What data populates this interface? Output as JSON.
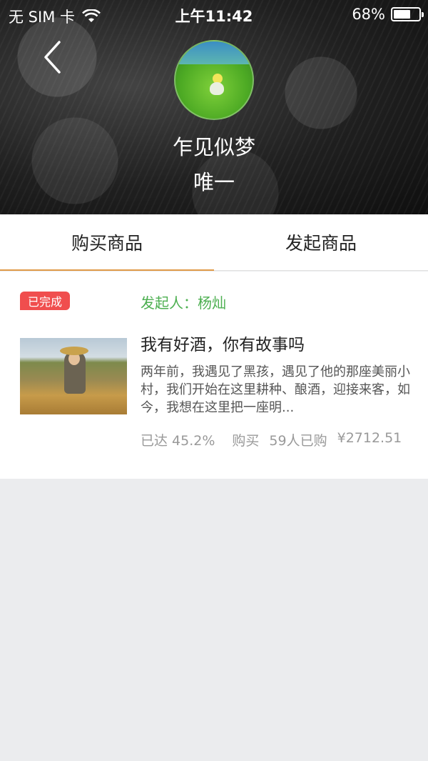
{
  "status_bar": {
    "carrier": "无 SIM 卡",
    "time": "上午11:42",
    "battery_percent": "68%",
    "battery_level": 0.68
  },
  "profile": {
    "username": "乍见似梦",
    "signature": "唯一"
  },
  "tabs": [
    {
      "label": "购买商品",
      "active": true
    },
    {
      "label": "发起商品",
      "active": false
    }
  ],
  "item": {
    "status_badge": "已完成",
    "initiator": "发起人：杨灿",
    "title": "我有好酒，你有故事吗",
    "description": "两年前，我遇见了黑孩，遇见了他的那座美丽小村，我们开始在这里耕种、酿酒，迎接来客，如今，我想在这里把一座明...",
    "progress": "已达  45.2%",
    "purchase_label": "购买",
    "buyers": "59人已购",
    "amount": "¥2712.51"
  },
  "colors": {
    "accent_tab": "#e09a48",
    "badge": "#f04e4e",
    "initiator": "#4caf50",
    "background": "#ebecee"
  }
}
